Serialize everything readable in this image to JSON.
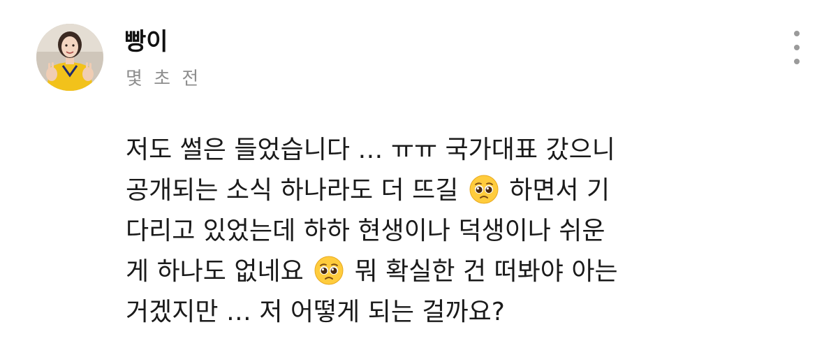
{
  "comment": {
    "author": "빵이",
    "timestamp": "몇 초 전",
    "more_icon": "more-vertical-icon",
    "body_lines": [
      [
        "저도 썰은 들었습니다 … ㅠㅠ 국가대표 갔으니"
      ],
      [
        "공개되는 소식 하나라도 더 뜨길 ",
        " 하면서 기"
      ],
      [
        "다리고 있었는데 하하 현생이나 덕생이나 쉬운"
      ],
      [
        "게 하나도 없네요 ",
        " 뭐 확실한 건 떠봐야 아는"
      ],
      [
        "거겠지만 … 저 어떻게 되는 걸까요?"
      ]
    ],
    "emoji_name": "pleading-face-emoji"
  }
}
